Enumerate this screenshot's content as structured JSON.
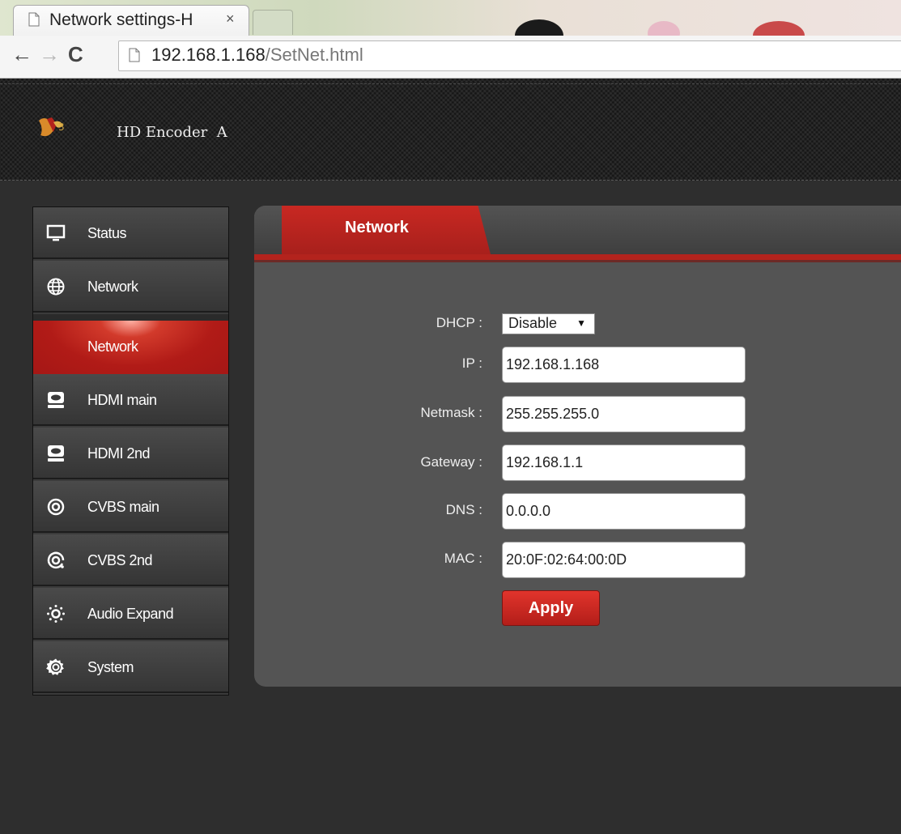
{
  "browser": {
    "tab_title": "Network settings-H",
    "tab_close": "×",
    "url_host": "192.168.1.168",
    "url_path": "/SetNet.html"
  },
  "header": {
    "device_name": "HD Encoder  A"
  },
  "sidebar": {
    "items": [
      {
        "label": "Status",
        "icon": "monitor-icon"
      },
      {
        "label": "Network",
        "icon": "globe-icon"
      },
      {
        "label": "Network",
        "icon": "",
        "active": true
      },
      {
        "label": "HDMI main",
        "icon": "hdmi-icon"
      },
      {
        "label": "HDMI 2nd",
        "icon": "hdmi-icon"
      },
      {
        "label": "CVBS main",
        "icon": "cvbs-icon"
      },
      {
        "label": "CVBS 2nd",
        "icon": "cvbs-icon"
      },
      {
        "label": "Audio Expand",
        "icon": "audio-icon"
      },
      {
        "label": "System",
        "icon": "gear-icon"
      }
    ]
  },
  "tabs": {
    "active_label": "Network"
  },
  "form": {
    "dhcp_label": "DHCP :",
    "dhcp_value": "Disable",
    "ip_label": "IP :",
    "ip_value": "192.168.1.168",
    "netmask_label": "Netmask :",
    "netmask_value": "255.255.255.0",
    "gateway_label": "Gateway :",
    "gateway_value": "192.168.1.1",
    "dns_label": "DNS :",
    "dns_value": "0.0.0.0",
    "mac_label": "MAC :",
    "mac_value": "20:0F:02:64:00:0D",
    "apply_label": "Apply"
  },
  "colors": {
    "accent_red": "#b3231d",
    "panel_gray": "#545454",
    "background": "#2e2e2e"
  }
}
